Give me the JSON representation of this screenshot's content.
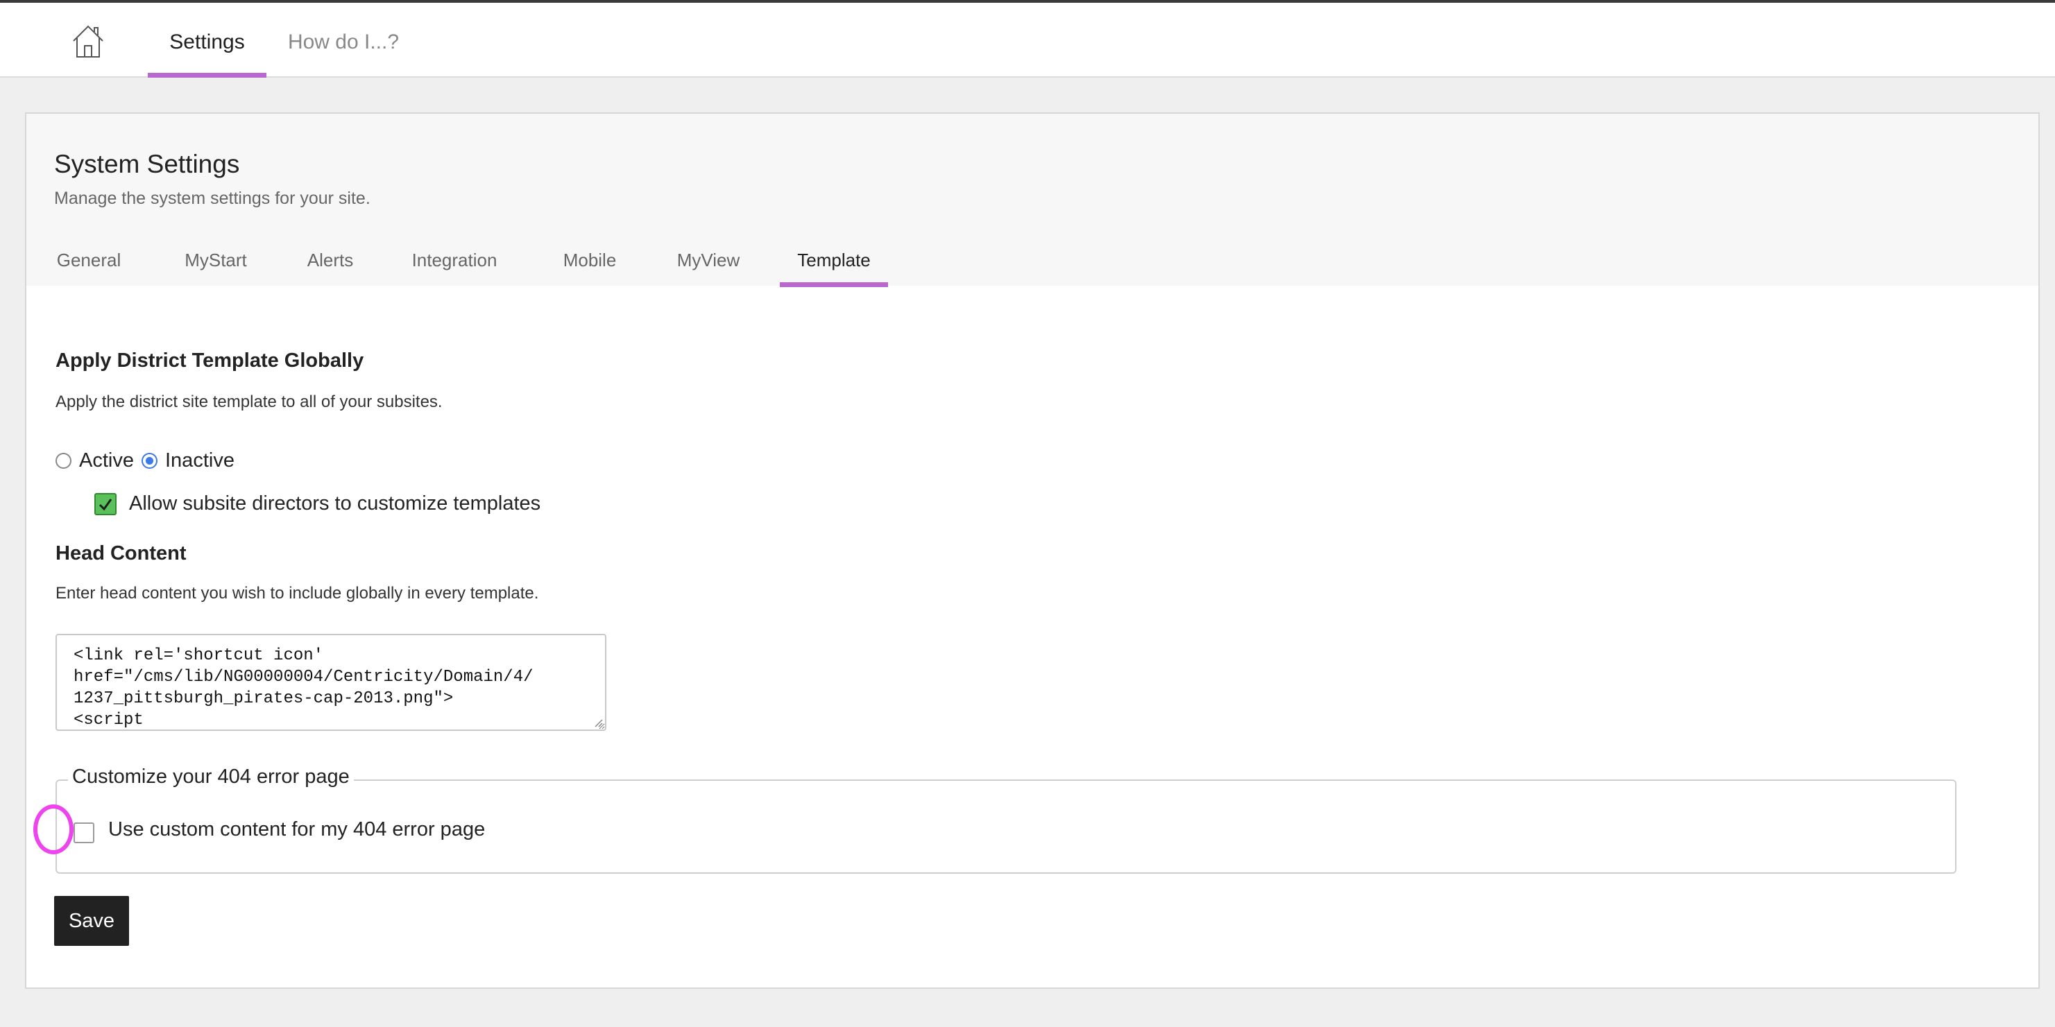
{
  "topbar": {
    "home_icon": "home-icon",
    "tabs": [
      {
        "label": "Settings",
        "active": true
      },
      {
        "label": "How do I...?",
        "active": false
      }
    ],
    "accent_color": "#b968cf"
  },
  "page": {
    "title": "System Settings",
    "subtitle": "Manage the system settings for your site.",
    "tabs": [
      {
        "label": "General",
        "active": false
      },
      {
        "label": "MyStart",
        "active": false
      },
      {
        "label": "Alerts",
        "active": false
      },
      {
        "label": "Integration",
        "active": false
      },
      {
        "label": "Mobile",
        "active": false
      },
      {
        "label": "MyView",
        "active": false
      },
      {
        "label": "Template",
        "active": true
      }
    ]
  },
  "template": {
    "apply_title": "Apply District Template Globally",
    "apply_desc": "Apply the district site template to all of your subsites.",
    "radio_active_label": "Active",
    "radio_inactive_label": "Inactive",
    "selected_status": "Inactive",
    "allow_customize_label": "Allow subsite directors to customize templates",
    "allow_customize_checked": true,
    "head_title": "Head Content",
    "head_desc": "Enter head content you wish to include globally in every template.",
    "head_value": "<link rel='shortcut icon'\nhref=\"/cms/lib/NG00000004/Centricity/Domain/4/\n1237_pittsburgh_pirates-cap-2013.png\">\n<script",
    "error_legend": "Customize your 404 error page",
    "error_checkbox_label": "Use custom content for my 404 error page",
    "error_checkbox_checked": false,
    "save_label": "Save"
  }
}
